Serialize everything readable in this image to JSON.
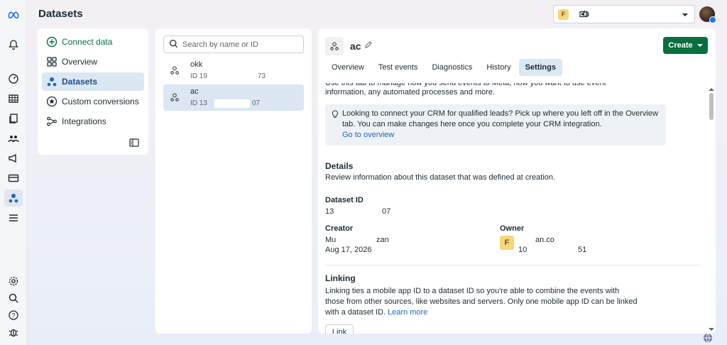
{
  "header": {
    "title": "Datasets"
  },
  "account": {
    "badge": "F",
    "name": "fa"
  },
  "nav": {
    "items": [
      {
        "label": "Connect data",
        "icon": "plus-circle-icon"
      },
      {
        "label": "Overview",
        "icon": "grid-icon"
      },
      {
        "label": "Datasets",
        "icon": "dataset-icon"
      },
      {
        "label": "Custom conversions",
        "icon": "star-circle-icon"
      },
      {
        "label": "Integrations",
        "icon": "integration-icon"
      }
    ]
  },
  "search": {
    "placeholder": "Search by name or ID"
  },
  "datasets": [
    {
      "name": "okk",
      "id_prefix": "ID 19",
      "id_suffix": "73"
    },
    {
      "name": "ac",
      "id_prefix": "ID 13",
      "id_suffix": "07"
    }
  ],
  "detail": {
    "name": "ac",
    "create_label": "Create",
    "tabs": [
      "Overview",
      "Test events",
      "Diagnostics",
      "History",
      "Settings"
    ],
    "active_tab": "Settings",
    "intro_line1": "Use this tab to manage how you send events to Meta, how you want to use event",
    "intro_line2": "information, any automated processes and more.",
    "info_text": "Looking to connect your CRM for qualified leads? Pick up where you left off in the Overview tab. You can make changes here once you complete your CRM integration.",
    "info_link": "Go to overview",
    "details_title": "Details",
    "details_desc": "Review information about this dataset that was defined at creation.",
    "dataset_id_label": "Dataset ID",
    "dataset_id_prefix": "13",
    "dataset_id_suffix": "07",
    "creator_label": "Creator",
    "creator_name_a": "Mu",
    "creator_name_b": "zan",
    "creator_date": "Aug 17, 2026",
    "owner_label": "Owner",
    "owner_badge": "F",
    "owner_domain": "an.co",
    "owner_id_prefix": "10",
    "owner_id_suffix": "51",
    "linking_title": "Linking",
    "linking_text": "Linking ties a mobile app ID to a dataset ID so you're able to combine the events with those from other sources, like websites and servers. Only one mobile app ID can be linked with a dataset ID.",
    "learn_more": "Learn more",
    "link_button": "Link"
  },
  "colors": {
    "primary_green": "#0a6e3f",
    "active_blue": "#dbe7f3",
    "link_blue": "#1d65c1"
  }
}
